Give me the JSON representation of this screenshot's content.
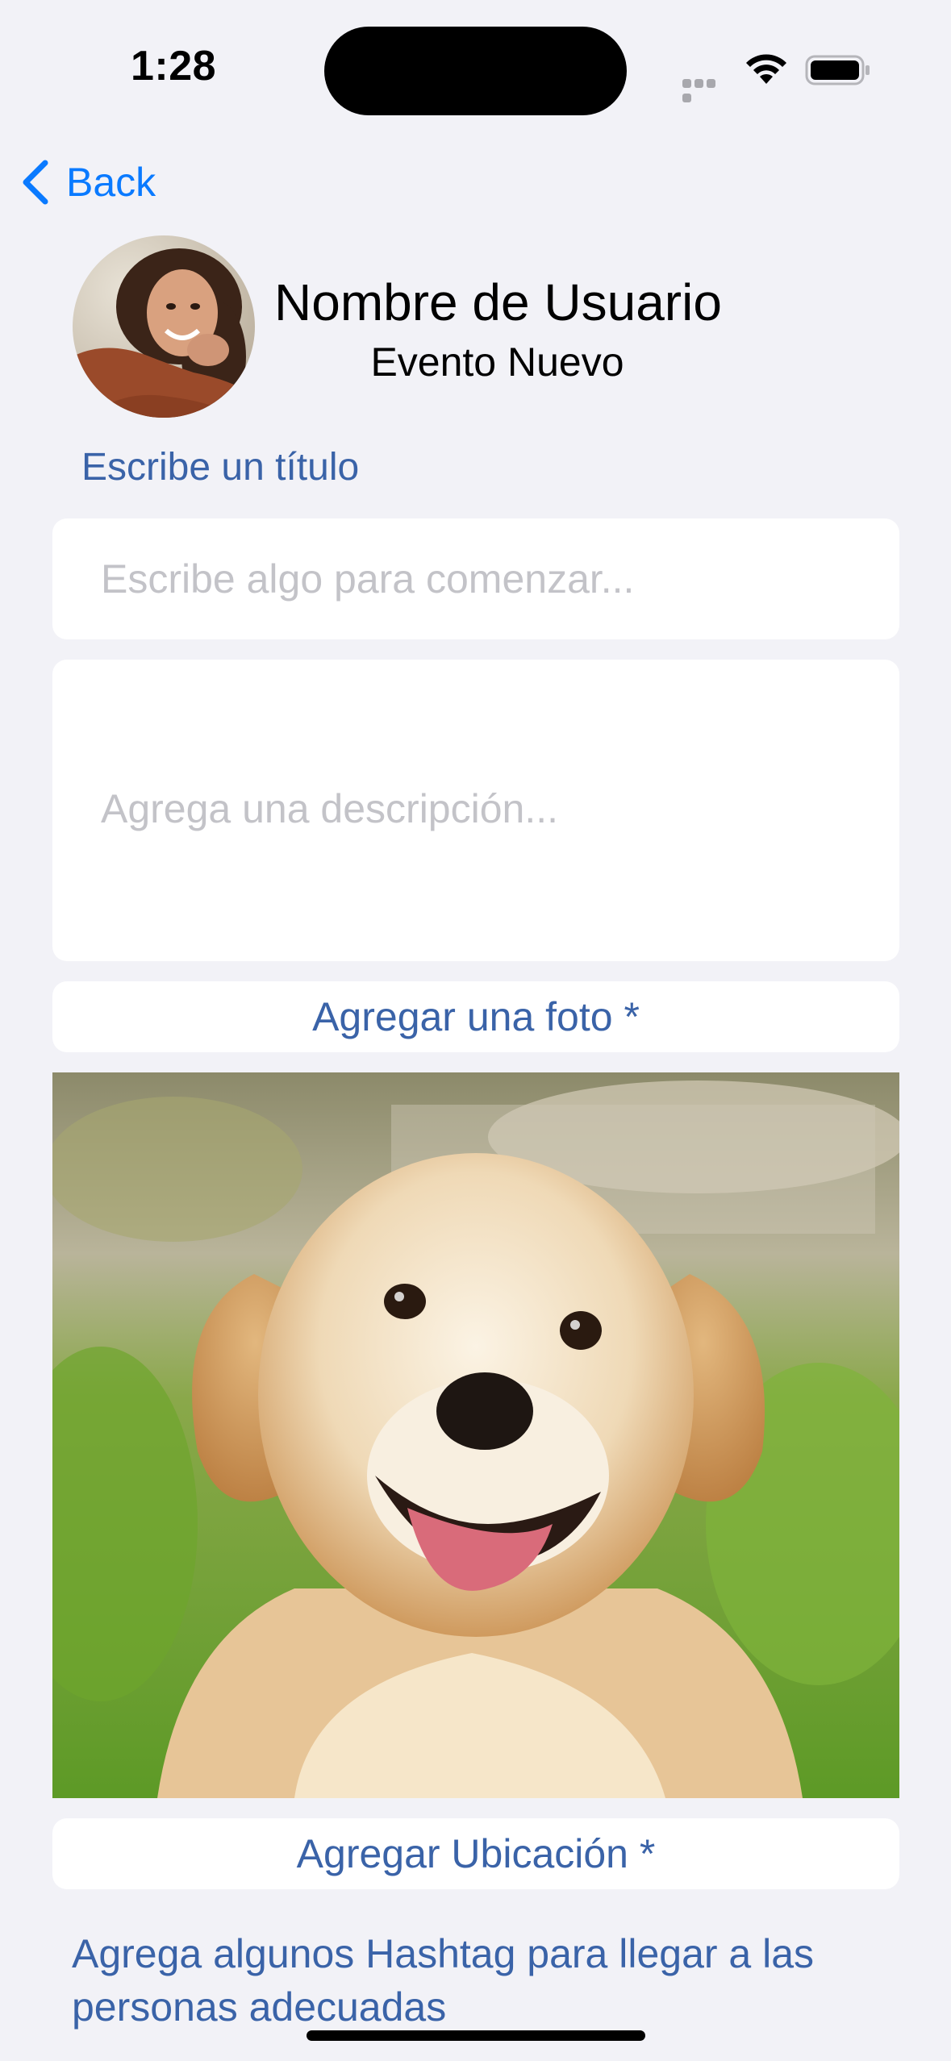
{
  "status_bar": {
    "time": "1:28",
    "icons": [
      "cellular-signal-icon",
      "wifi-icon",
      "battery-icon"
    ]
  },
  "nav": {
    "back_label": "Back",
    "back_icon": "chevron-left-icon"
  },
  "header": {
    "user_name": "Nombre de Usuario",
    "subtitle": "Evento Nuevo"
  },
  "form": {
    "title_label": "Escribe un título",
    "title_input": {
      "value": "",
      "placeholder": "Escribe algo para comenzar..."
    },
    "description_input": {
      "value": "",
      "placeholder": "Agrega una descripción..."
    },
    "add_photo_label": "Agregar una foto *",
    "add_location_label": "Agregar Ubicación *",
    "hashtag_hint": "Agrega algunos Hashtag para llegar a las personas adecuadas"
  },
  "colors": {
    "background": "#f2f2f7",
    "accent_link": "#0a7aff",
    "label_blue": "#3a63a8",
    "placeholder": "#c3c3c8",
    "card": "#ffffff"
  }
}
